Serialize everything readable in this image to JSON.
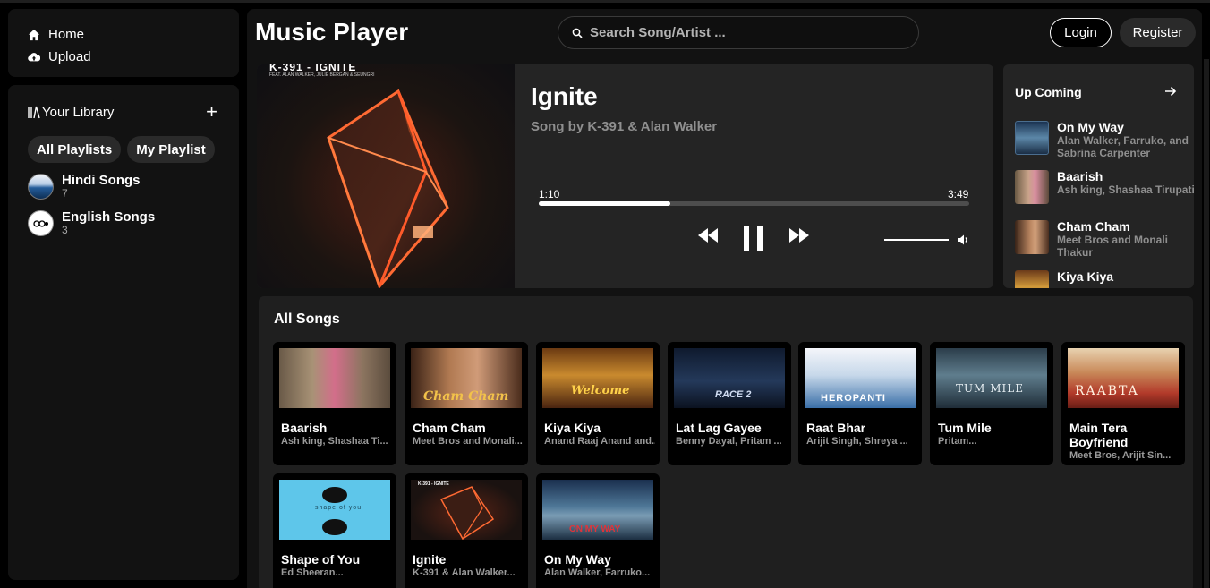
{
  "nav": {
    "home": "Home",
    "upload": "Upload"
  },
  "library": {
    "title": "Your Library",
    "chips": [
      "All Playlists",
      "My Playlist"
    ],
    "playlists": [
      {
        "name": "Hindi Songs",
        "count": "7"
      },
      {
        "name": "English Songs",
        "count": "3"
      }
    ]
  },
  "header": {
    "app_title": "Music Player",
    "search_placeholder": "Search Song/Artist ...",
    "login": "Login",
    "register": "Register"
  },
  "player": {
    "cover_title": "K-391 - IGNITE",
    "cover_subtitle": "FEAT. ALAN WALKER, JULIE BERGAN & SEUNGRI",
    "song_title": "Ignite",
    "song_by": "Song by K-391 & Alan Walker",
    "current_time": "1:10",
    "total_time": "3:49",
    "progress_fraction": 0.305,
    "volume_fraction": 1.0
  },
  "upcoming": {
    "title": "Up Coming",
    "items": [
      {
        "name": "On My Way",
        "artist": "Alan Walker, Farruko, and Sabrina Carpenter"
      },
      {
        "name": "Baarish",
        "artist": "Ash king, Shashaa Tirupati"
      },
      {
        "name": "Cham Cham",
        "artist": "Meet Bros and Monali Thakur"
      },
      {
        "name": "Kiya Kiya",
        "artist": ""
      }
    ]
  },
  "all_songs": {
    "title": "All Songs",
    "cards": [
      {
        "name": "Baarish",
        "artist": "Ash king, Shashaa Ti...",
        "cover_text": ""
      },
      {
        "name": "Cham Cham",
        "artist": "Meet Bros and Monali...",
        "cover_text": "Cham Cham"
      },
      {
        "name": "Kiya Kiya",
        "artist": "Anand Raaj Anand and...",
        "cover_text": "Welcome"
      },
      {
        "name": "Lat Lag Gayee",
        "artist": "Benny Dayal, Pritam ...",
        "cover_text": "RACE 2"
      },
      {
        "name": "Raat Bhar",
        "artist": "Arijit Singh, Shreya ...",
        "cover_text": "HEROPANTI"
      },
      {
        "name": "Tum Mile",
        "artist": "Pritam...",
        "cover_text": "TUM MILE"
      },
      {
        "name": "Main Tera Boyfriend",
        "artist": "Meet Bros, Arijit Sin...",
        "cover_text": "RAABTA"
      },
      {
        "name": "Shape of You",
        "artist": "Ed Sheeran...",
        "cover_text": "shape of you"
      },
      {
        "name": "Ignite",
        "artist": "K-391 & Alan Walker...",
        "cover_text": "K-391 - IGNITE"
      },
      {
        "name": "On My Way",
        "artist": "Alan Walker, Farruko...",
        "cover_text": "ON MY WAY"
      }
    ]
  },
  "colors": {
    "background": "#000000",
    "panel": "#121212",
    "card_bg": "#242424",
    "muted_text": "#8f8f8f",
    "accent_glow": "#ff5a2a"
  }
}
